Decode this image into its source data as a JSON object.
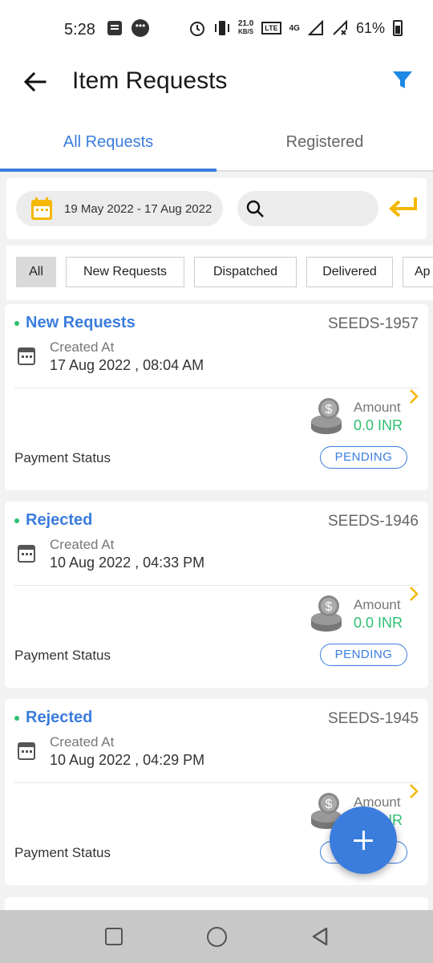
{
  "status_bar": {
    "time": "5:28",
    "speed_top": "21.0",
    "speed_bottom": "KB/S",
    "lte": "LTE",
    "network": "4G",
    "battery": "61%"
  },
  "header": {
    "title": "Item Requests"
  },
  "tabs": [
    {
      "label": "All Requests",
      "active": true
    },
    {
      "label": "Registered",
      "active": false
    }
  ],
  "search": {
    "date_range": "19 May 2022 - 17 Aug 2022",
    "placeholder": ""
  },
  "chips": [
    "All",
    "New Requests",
    "Dispatched",
    "Delivered",
    "Ap"
  ],
  "cards": [
    {
      "status": "New Requests",
      "id": "SEEDS-1957",
      "created_label": "Created At",
      "created_value": "17 Aug 2022 , 08:04 AM",
      "amount_label": "Amount",
      "amount_value": "0.0 INR",
      "payment_label": "Payment Status",
      "payment_status": "PENDING"
    },
    {
      "status": "Rejected",
      "id": "SEEDS-1946",
      "created_label": "Created At",
      "created_value": "10 Aug 2022 , 04:33 PM",
      "amount_label": "Amount",
      "amount_value": "0.0 INR",
      "payment_label": "Payment Status",
      "payment_status": "PENDING"
    },
    {
      "status": "Rejected",
      "id": "SEEDS-1945",
      "created_label": "Created At",
      "created_value": "10 Aug 2022 , 04:29 PM",
      "amount_label": "Amount",
      "amount_value": "0.0 INR",
      "payment_label": "Payment Status",
      "payment_status": "PENDING"
    }
  ],
  "colors": {
    "accent": "#3b7ddd",
    "success": "#2fbf71",
    "warning": "#f5b700"
  },
  "icons": {
    "back": "arrow-left-icon",
    "filter": "funnel-icon",
    "calendar": "calendar-icon",
    "search": "search-icon",
    "enter": "enter-arrow-icon",
    "amount": "coins-icon",
    "chevron": "chevron-right-icon",
    "fab": "plus-icon"
  }
}
